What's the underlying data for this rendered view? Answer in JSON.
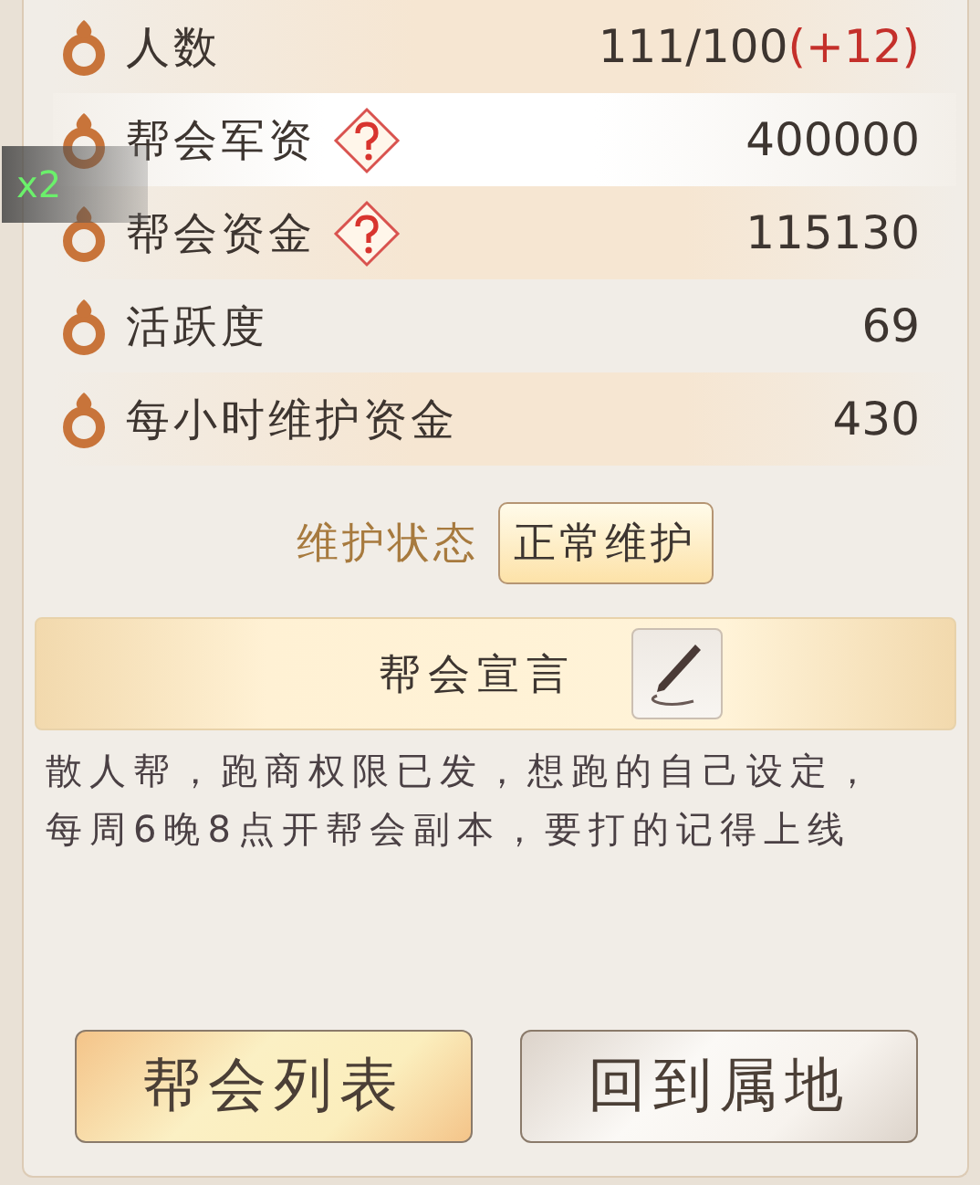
{
  "overlay_badge": "x2",
  "stats": [
    {
      "label": "人数",
      "value": "111/100",
      "bonus": "(+12)",
      "help": false,
      "selected": false
    },
    {
      "label": "帮会军资",
      "value": "400000",
      "help": true,
      "selected": true
    },
    {
      "label": "帮会资金",
      "value": "115130",
      "help": true,
      "selected": false
    },
    {
      "label": "活跃度",
      "value": "69",
      "help": false,
      "selected": false
    },
    {
      "label": "每小时维护资金",
      "value": "430",
      "help": false,
      "selected": false
    }
  ],
  "maintenance": {
    "label": "维护状态",
    "status": "正常维护"
  },
  "declaration": {
    "title": "帮会宣言",
    "text": "散人帮，跑商权限已发，想跑的自己设定，每周6晚8点开帮会副本，要打的记得上线"
  },
  "buttons": [
    {
      "label": "帮会列表",
      "kind": "primary"
    },
    {
      "label": "回到属地",
      "kind": "secondary"
    }
  ]
}
